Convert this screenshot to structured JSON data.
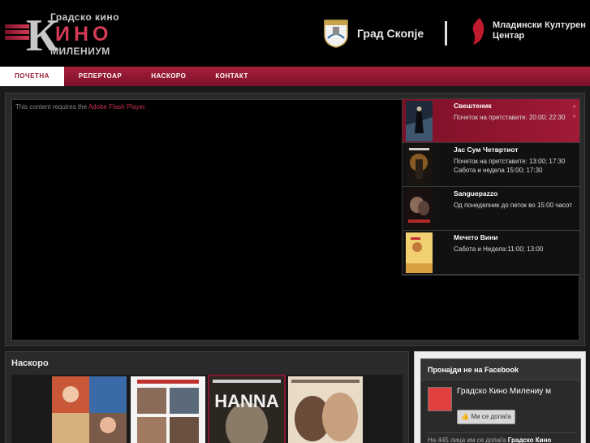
{
  "header": {
    "logo": {
      "line_top": "Градско кино",
      "line_mid": "ИНО",
      "line_bottom": "МИЛЕНИУМ",
      "big_letter": "К"
    },
    "sponsor_city": "Град Скопје",
    "sponsor_center": [
      "Младински Културен",
      "Центар"
    ]
  },
  "nav": {
    "items": [
      {
        "label": "ПОЧЕТНА",
        "active": true
      },
      {
        "label": "РЕПЕРТОАР",
        "active": false
      },
      {
        "label": "НАСКОРО",
        "active": false
      },
      {
        "label": "КОНТАКТ",
        "active": false
      }
    ]
  },
  "feature": {
    "flash_text": "This content requires the ",
    "flash_link": "Adobe Flash Player.",
    "movies": [
      {
        "title": "Свештеник",
        "info": "Почеток на претставите: 20:00; 22:30",
        "selected": true
      },
      {
        "title": "Јас Сум Четвртиот",
        "info": "Почеток на претставите: 13:00; 17:30 Сабота и недела 15:00; 17:30",
        "selected": false
      },
      {
        "title": "Sanguepazzo",
        "info": "Од понеделник до петок во 15:00 часот",
        "selected": false
      },
      {
        "title": "Мечето Вини",
        "info": "Сабота и Недела:11:00; 13:00",
        "selected": false
      }
    ],
    "arrow_up": "˄",
    "arrow_down": "˅"
  },
  "soon": {
    "title": "Наскоро"
  },
  "facebook": {
    "title": "Пронајди не на Facebook",
    "page_name": "Градско Кино Милениу м",
    "like_label": "Ми се допаѓа",
    "count_text": "На 445 лица им се допаѓа ",
    "count_page": "Градско Кино"
  },
  "colors": {
    "accent": "#9a1a33",
    "nav": "#a81e3a"
  }
}
